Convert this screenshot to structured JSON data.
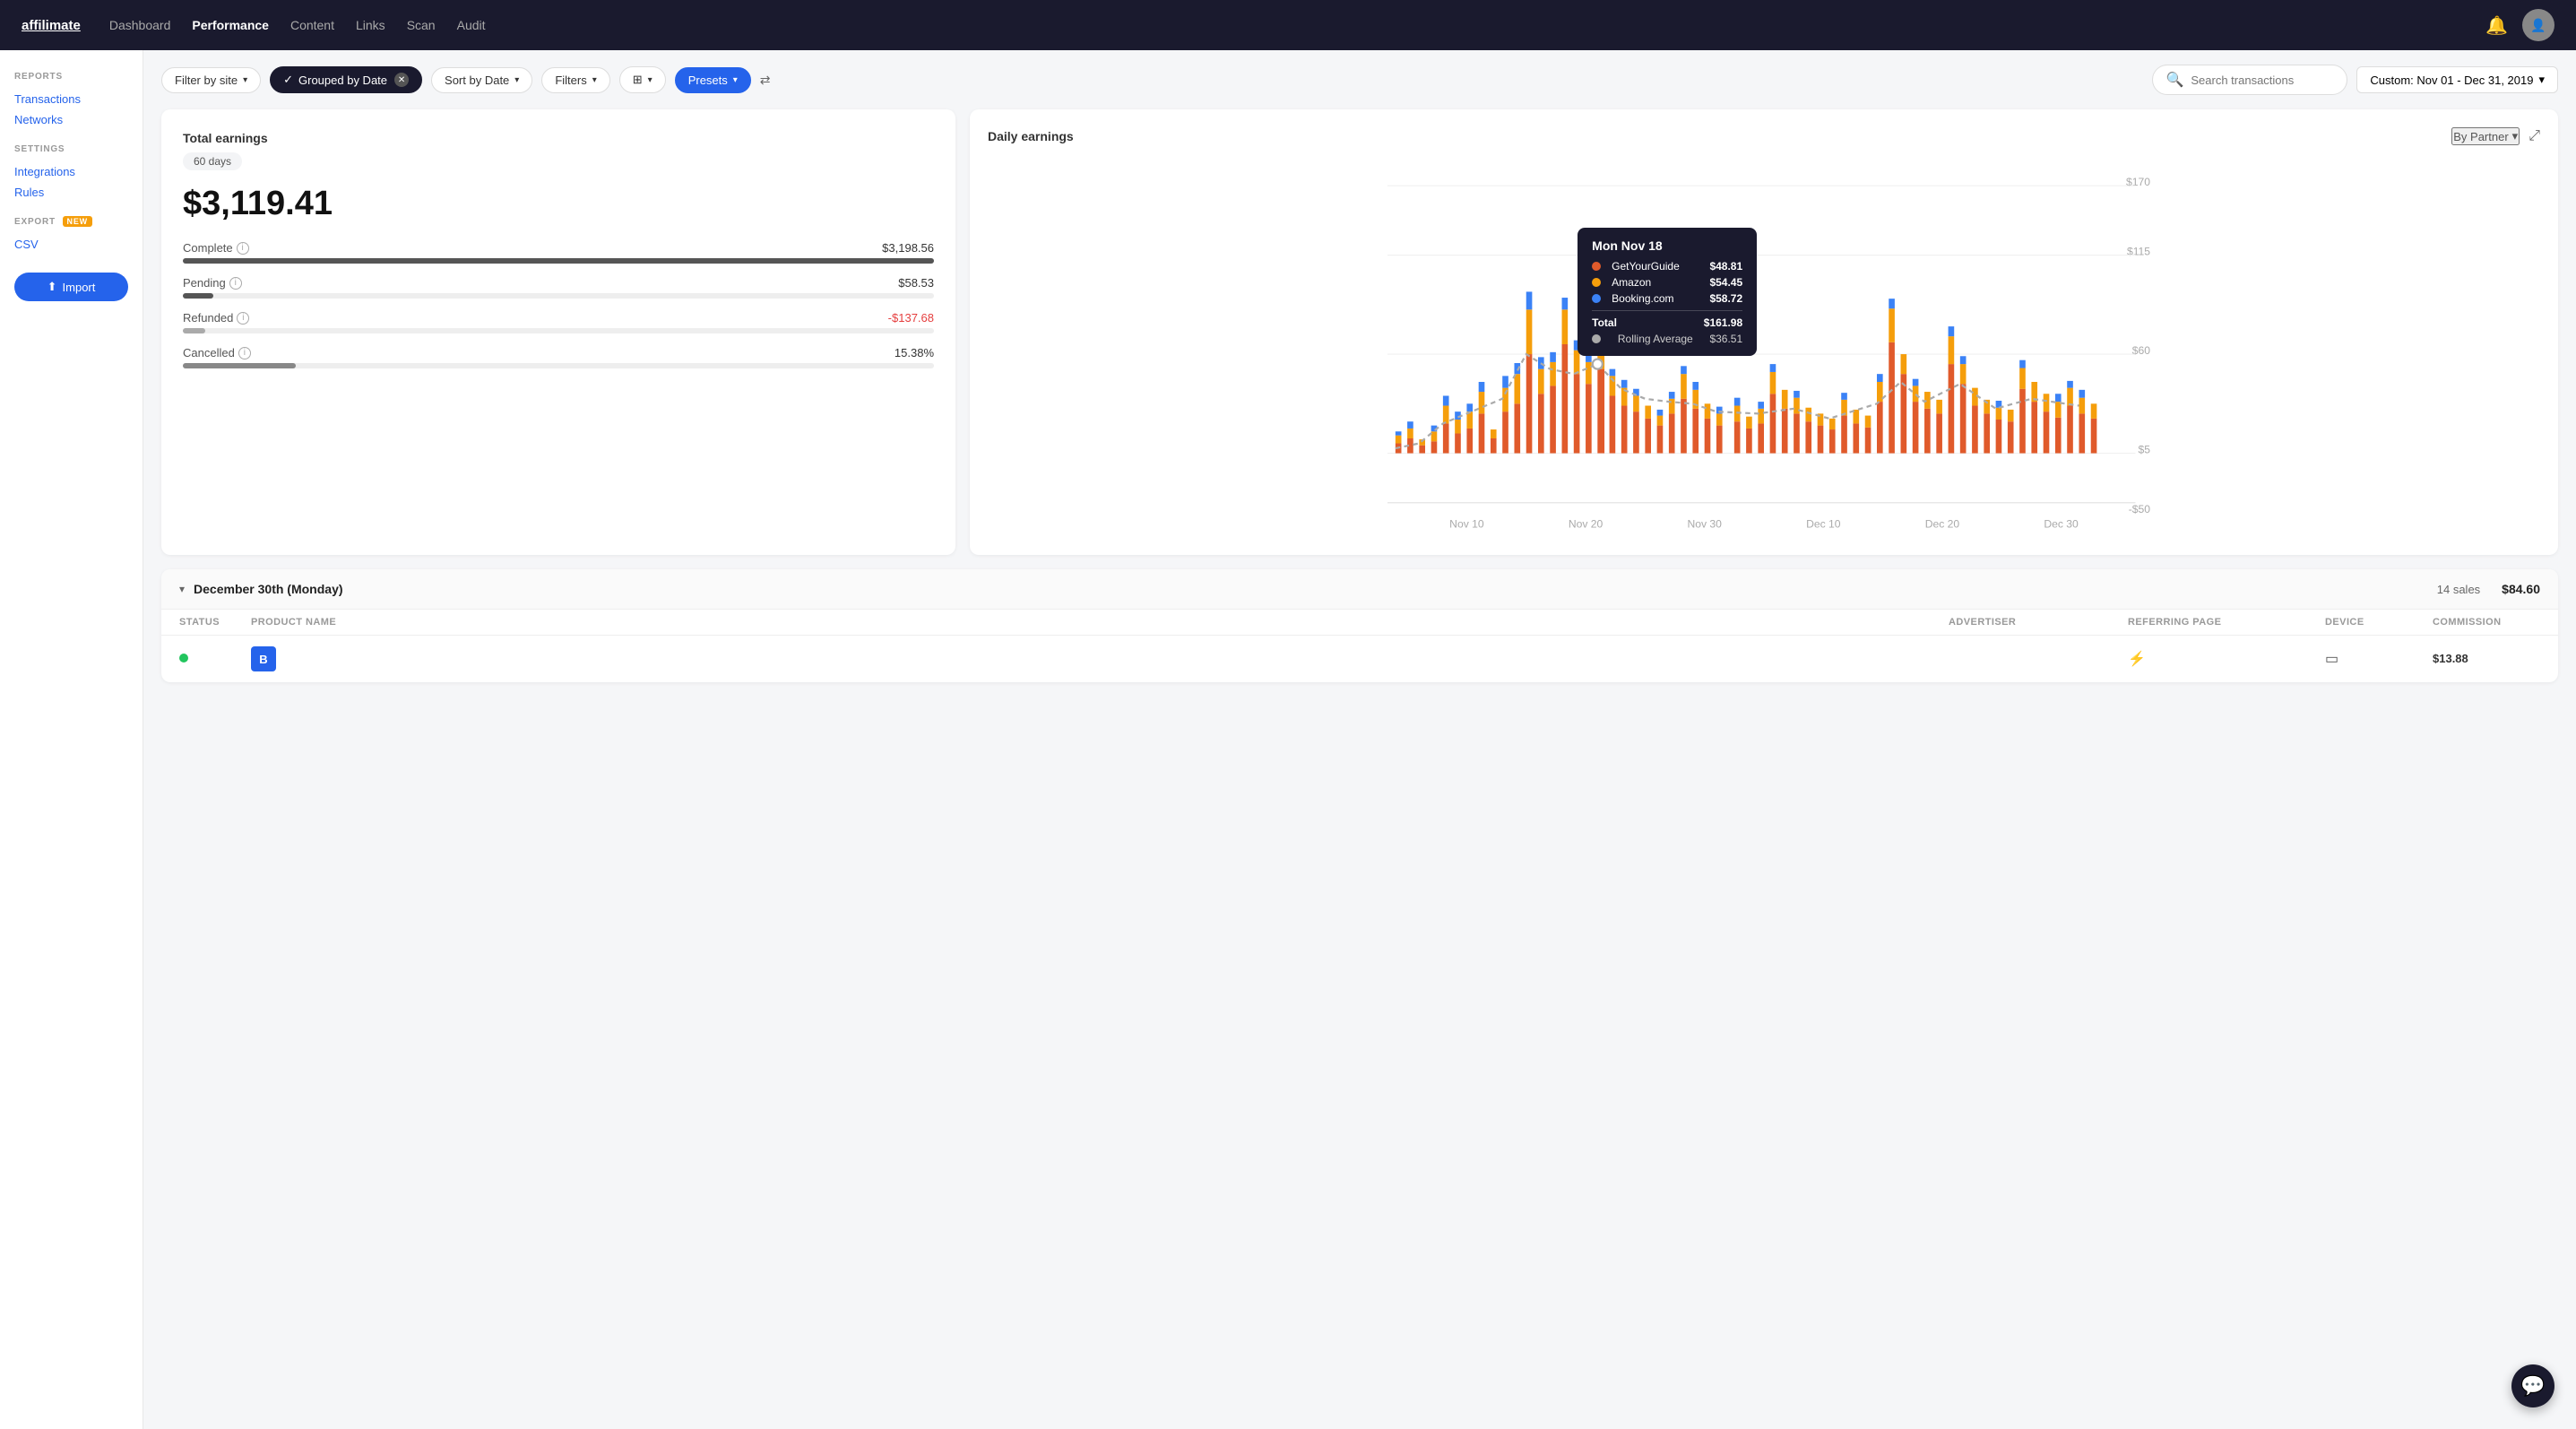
{
  "topnav": {
    "logo": "affilimate",
    "links": [
      {
        "label": "Dashboard",
        "active": false
      },
      {
        "label": "Performance",
        "active": true
      },
      {
        "label": "Content",
        "active": false
      },
      {
        "label": "Links",
        "active": false
      },
      {
        "label": "Scan",
        "active": false
      },
      {
        "label": "Audit",
        "active": false
      }
    ]
  },
  "sidebar": {
    "reports_label": "REPORTS",
    "reports_links": [
      {
        "label": "Transactions"
      },
      {
        "label": "Networks"
      }
    ],
    "settings_label": "SETTINGS",
    "settings_links": [
      {
        "label": "Integrations"
      },
      {
        "label": "Rules"
      }
    ],
    "export_label": "EXPORT",
    "csv_link": "CSV",
    "import_btn": "Import"
  },
  "filterbar": {
    "filter_by_site": "Filter by site",
    "grouped_by_date": "Grouped by Date",
    "sort_by_date": "Sort by Date",
    "filters": "Filters",
    "presets": "Presets",
    "search_placeholder": "Search transactions",
    "date_range": "Custom: Nov 01 - Dec 31, 2019"
  },
  "earnings_card": {
    "title": "Total earnings",
    "days": "60 days",
    "total": "$3,119.41",
    "complete_label": "Complete",
    "complete_value": "$3,198.56",
    "pending_label": "Pending",
    "pending_value": "$58.53",
    "refunded_label": "Refunded",
    "refunded_value": "-$137.68",
    "cancelled_label": "Cancelled",
    "cancelled_value": "15.38%"
  },
  "chart_card": {
    "title": "Daily earnings",
    "by_partner": "By Partner",
    "tooltip": {
      "date": "Mon Nov 18",
      "rows": [
        {
          "label": "GetYourGuide",
          "value": "$48.81",
          "color": "#e05a2b"
        },
        {
          "label": "Amazon",
          "value": "$54.45",
          "color": "#f59e0b"
        },
        {
          "label": "Booking.com",
          "value": "$58.72",
          "color": "#3b82f6"
        }
      ],
      "total_label": "Total",
      "total_value": "$161.98",
      "avg_label": "Rolling Average",
      "avg_value": "$36.51"
    },
    "y_labels": [
      "$170",
      "$115",
      "$60",
      "$5",
      "-$50"
    ],
    "x_labels": [
      "Nov 10",
      "Nov 20",
      "Nov 30",
      "Dec 10",
      "Dec 20",
      "Dec 30"
    ]
  },
  "transactions": {
    "group_label": "December 30th (Monday)",
    "group_sales": "14 sales",
    "group_amount": "$84.60",
    "table_headers": [
      "Status",
      "Product name",
      "Advertiser",
      "Referring Page",
      "Device",
      "Commission"
    ],
    "rows": [
      {
        "status_color": "#22c55e",
        "product_icon": "B",
        "product_icon_color": "#2563eb",
        "product_name": "",
        "advertiser": "",
        "referring_icon": "⚡",
        "referring_color": "#f59e0b",
        "device_icon": "▭",
        "commission": "$13.88"
      }
    ]
  }
}
